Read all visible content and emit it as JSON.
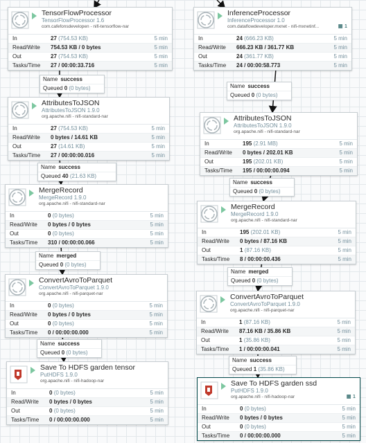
{
  "processors": {
    "tf": {
      "name": "TensorFlowProcessor",
      "type": "TensorFlowProcessor 1.6",
      "bundle": "com.cafefonsdevelopen - nifi-tensorflow-nar",
      "stats": [
        {
          "label": "In",
          "value": "27",
          "paren": "(754.53 KB)",
          "time": "5 min"
        },
        {
          "label": "Read/Write",
          "value": "754.53 KB / 0 bytes",
          "paren": "",
          "time": "5 min"
        },
        {
          "label": "Out",
          "value": "27",
          "paren": "(754.53 KB)",
          "time": "5 min"
        },
        {
          "label": "Tasks/Time",
          "value": "27 / 00:00:33.716",
          "paren": "",
          "time": "5 min"
        }
      ]
    },
    "inf": {
      "name": "InferenceProcessor",
      "type": "InferenceProcessor 1.0",
      "bundle": "com.dataflowdeveloper.mxnet - nifi-mxnetinf...",
      "badge": "1",
      "stats": [
        {
          "label": "In",
          "value": "24",
          "paren": "(666.23 KB)",
          "time": "5 min"
        },
        {
          "label": "Read/Write",
          "value": "666.23 KB / 361.77 KB",
          "paren": "",
          "time": "5 min"
        },
        {
          "label": "Out",
          "value": "24",
          "paren": "(361.77 KB)",
          "time": "5 min"
        },
        {
          "label": "Tasks/Time",
          "value": "24 / 00:00:58.773",
          "paren": "",
          "time": "5 min"
        }
      ]
    },
    "atj_l": {
      "name": "AttributesToJSON",
      "type": "AttributesToJSON 1.9.0",
      "bundle": "org.apache.nifi - nifi-standard-nar",
      "stats": [
        {
          "label": "In",
          "value": "27",
          "paren": "(754.53 KB)",
          "time": "5 min"
        },
        {
          "label": "Read/Write",
          "value": "0 bytes / 14.61 KB",
          "paren": "",
          "time": "5 min"
        },
        {
          "label": "Out",
          "value": "27",
          "paren": "(14.61 KB)",
          "time": "5 min"
        },
        {
          "label": "Tasks/Time",
          "value": "27 / 00:00:00.016",
          "paren": "",
          "time": "5 min"
        }
      ]
    },
    "atj_r": {
      "name": "AttributesToJSON",
      "type": "AttributesToJSON 1.9.0",
      "bundle": "org.apache.nifi - nifi-standard-nar",
      "stats": [
        {
          "label": "In",
          "value": "195",
          "paren": "(2.91 MB)",
          "time": "5 min"
        },
        {
          "label": "Read/Write",
          "value": "0 bytes / 202.01 KB",
          "paren": "",
          "time": "5 min"
        },
        {
          "label": "Out",
          "value": "195",
          "paren": "(202.01 KB)",
          "time": "5 min"
        },
        {
          "label": "Tasks/Time",
          "value": "195 / 00:00:00.094",
          "paren": "",
          "time": "5 min"
        }
      ]
    },
    "mr_l": {
      "name": "MergeRecord",
      "type": "MergeRecord 1.9.0",
      "bundle": "org.apache.nifi - nifi-standard-nar",
      "stats": [
        {
          "label": "In",
          "value": "0",
          "paren": "(0 bytes)",
          "time": "5 min"
        },
        {
          "label": "Read/Write",
          "value": "0 bytes / 0 bytes",
          "paren": "",
          "time": "5 min"
        },
        {
          "label": "Out",
          "value": "0",
          "paren": "(0 bytes)",
          "time": "5 min"
        },
        {
          "label": "Tasks/Time",
          "value": "310 / 00:00:00.066",
          "paren": "",
          "time": "5 min"
        }
      ]
    },
    "mr_r": {
      "name": "MergeRecord",
      "type": "MergeRecord 1.9.0",
      "bundle": "org.apache.nifi - nifi-standard-nar",
      "stats": [
        {
          "label": "In",
          "value": "195",
          "paren": "(202.01 KB)",
          "time": "5 min"
        },
        {
          "label": "Read/Write",
          "value": "0 bytes / 87.16 KB",
          "paren": "",
          "time": "5 min"
        },
        {
          "label": "Out",
          "value": "1",
          "paren": "(87.16 KB)",
          "time": "5 min"
        },
        {
          "label": "Tasks/Time",
          "value": "8 / 00:00:00.436",
          "paren": "",
          "time": "5 min"
        }
      ]
    },
    "cap_l": {
      "name": "ConvertAvroToParquet",
      "type": "ConvertAvroToParquet 1.9.0",
      "bundle": "org.apache.nifi - nifi-parquet-nar",
      "stats": [
        {
          "label": "In",
          "value": "0",
          "paren": "(0 bytes)",
          "time": "5 min"
        },
        {
          "label": "Read/Write",
          "value": "0 bytes / 0 bytes",
          "paren": "",
          "time": "5 min"
        },
        {
          "label": "Out",
          "value": "0",
          "paren": "(0 bytes)",
          "time": "5 min"
        },
        {
          "label": "Tasks/Time",
          "value": "0 / 00:00:00.000",
          "paren": "",
          "time": "5 min"
        }
      ]
    },
    "cap_r": {
      "name": "ConvertAvroToParquet",
      "type": "ConvertAvroToParquet 1.9.0",
      "bundle": "org.apache.nifi - nifi-parquet-nar",
      "stats": [
        {
          "label": "In",
          "value": "1",
          "paren": "(87.16 KB)",
          "time": "5 min"
        },
        {
          "label": "Read/Write",
          "value": "87.16 KB / 35.86 KB",
          "paren": "",
          "time": "5 min"
        },
        {
          "label": "Out",
          "value": "1",
          "paren": "(35.86 KB)",
          "time": "5 min"
        },
        {
          "label": "Tasks/Time",
          "value": "1 / 00:00:00.041",
          "paren": "",
          "time": "5 min"
        }
      ]
    },
    "hdfs_l": {
      "name": "Save To HDFS garden tensor",
      "type": "PutHDFS 1.9.0",
      "bundle": "org.apache.nifi - nifi-hadoop-nar",
      "stats": [
        {
          "label": "In",
          "value": "0",
          "paren": "(0 bytes)",
          "time": "5 min"
        },
        {
          "label": "Read/Write",
          "value": "0 bytes / 0 bytes",
          "paren": "",
          "time": "5 min"
        },
        {
          "label": "Out",
          "value": "0",
          "paren": "(0 bytes)",
          "time": "5 min"
        },
        {
          "label": "Tasks/Time",
          "value": "0 / 00:00:00.000",
          "paren": "",
          "time": "5 min"
        }
      ]
    },
    "hdfs_r": {
      "name": "Save To HDFS garden ssd",
      "type": "PutHDFS 1.9.0",
      "bundle": "org.apache.nifi - nifi-hadoop-nar",
      "badge": "1",
      "stats": [
        {
          "label": "In",
          "value": "0",
          "paren": "(0 bytes)",
          "time": "5 min"
        },
        {
          "label": "Read/Write",
          "value": "0 bytes / 0 bytes",
          "paren": "",
          "time": "5 min"
        },
        {
          "label": "Out",
          "value": "0",
          "paren": "(0 bytes)",
          "time": "5 min"
        },
        {
          "label": "Tasks/Time",
          "value": "0 / 00:00:00.000",
          "paren": "",
          "time": "5 min"
        }
      ]
    }
  },
  "connections": {
    "c1": {
      "name_key": "Name",
      "name": "success",
      "queued_key": "Queued",
      "count": "0",
      "paren": "(0 bytes)"
    },
    "c2": {
      "name_key": "Name",
      "name": "success",
      "queued_key": "Queued",
      "count": "0",
      "paren": "(0 bytes)"
    },
    "c3": {
      "name_key": "Name",
      "name": "success",
      "queued_key": "Queued",
      "count": "40",
      "paren": "(21.63 KB)"
    },
    "c4": {
      "name_key": "Name",
      "name": "success",
      "queued_key": "Queued",
      "count": "0",
      "paren": "(0 bytes)"
    },
    "c5": {
      "name_key": "Name",
      "name": "merged",
      "queued_key": "Queued",
      "count": "0",
      "paren": "(0 bytes)"
    },
    "c6": {
      "name_key": "Name",
      "name": "merged",
      "queued_key": "Queued",
      "count": "0",
      "paren": "(0 bytes)"
    },
    "c7": {
      "name_key": "Name",
      "name": "success",
      "queued_key": "Queued",
      "count": "0",
      "paren": "(0 bytes)"
    },
    "c8": {
      "name_key": "Name",
      "name": "success",
      "queued_key": "Queued",
      "count": "1",
      "paren": "(35.86 KB)"
    }
  },
  "colors": {
    "accent": "#004849",
    "canvas": "#f9fafb",
    "grid": "#e3e8eb",
    "running": "#7dc7a0",
    "muted": "#728e9b"
  }
}
